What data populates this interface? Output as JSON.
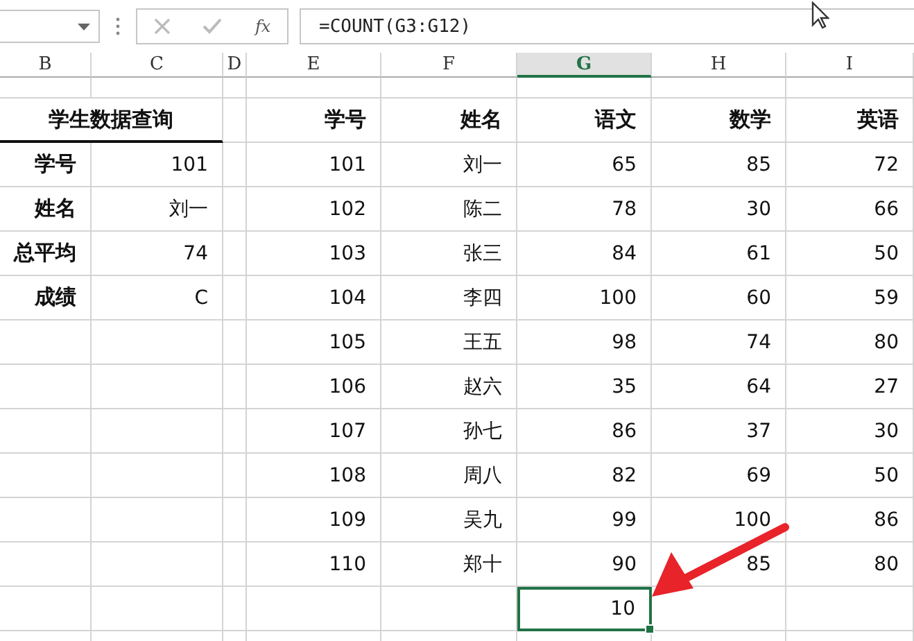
{
  "formula_bar": {
    "function_button": "fx",
    "formula": "=COUNT(G3:G12)"
  },
  "columns": [
    {
      "label": "B",
      "selected": false
    },
    {
      "label": "C",
      "selected": false
    },
    {
      "label": "D",
      "selected": false
    },
    {
      "label": "E",
      "selected": false
    },
    {
      "label": "F",
      "selected": false
    },
    {
      "label": "G",
      "selected": true
    },
    {
      "label": "H",
      "selected": false
    },
    {
      "label": "I",
      "selected": false
    }
  ],
  "lookup": {
    "title": "学生数据查询",
    "fields": [
      {
        "label": "学号",
        "value": "101"
      },
      {
        "label": "姓名",
        "value": "刘一"
      },
      {
        "label": "总平均",
        "value": "74"
      },
      {
        "label": "成绩",
        "value": "C"
      }
    ]
  },
  "table": {
    "columns": [
      "学号",
      "姓名",
      "语文",
      "数学",
      "英语"
    ],
    "rows": [
      [
        "101",
        "刘一",
        "65",
        "85",
        "72"
      ],
      [
        "102",
        "陈二",
        "78",
        "30",
        "66"
      ],
      [
        "103",
        "张三",
        "84",
        "61",
        "50"
      ],
      [
        "104",
        "李四",
        "100",
        "60",
        "59"
      ],
      [
        "105",
        "王五",
        "98",
        "74",
        "80"
      ],
      [
        "106",
        "赵六",
        "35",
        "64",
        "27"
      ],
      [
        "107",
        "孙七",
        "86",
        "37",
        "30"
      ],
      [
        "108",
        "周八",
        "82",
        "69",
        "50"
      ],
      [
        "109",
        "吴九",
        "99",
        "100",
        "86"
      ],
      [
        "110",
        "郑十",
        "90",
        "85",
        "80"
      ]
    ],
    "count": {
      "value": "10",
      "selected": true
    }
  }
}
